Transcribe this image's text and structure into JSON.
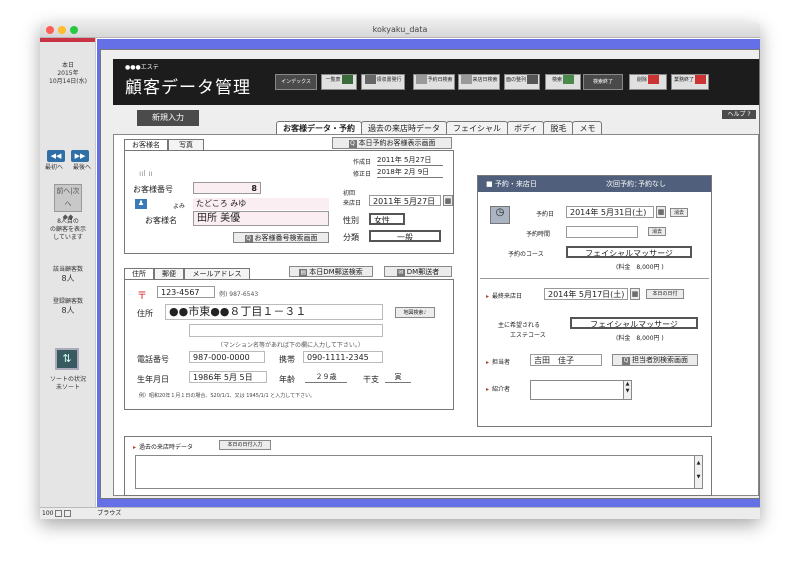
{
  "window": {
    "title": "kokyaku_data"
  },
  "sidebar": {
    "date_label": "本日",
    "date_year": "2015年",
    "date_md": "10月14日(水)",
    "nav_prev": "最初へ",
    "nav_last": "最後へ",
    "pad_prev": "前へ",
    "pad_next": "次へ",
    "record_info": "8人目の",
    "record_info2": "の顧客を表示",
    "record_info3": "しています",
    "found_label": "該当顧客数",
    "found_value": "8人",
    "total_label": "登録顧客数",
    "total_value": "8人",
    "sort_label": "ソートの状況",
    "sort_value": "未ソート"
  },
  "status": {
    "zoom": "100",
    "mode": "ブラウズ"
  },
  "header": {
    "subtitle": "●●●エステ",
    "title": "顧客データ管理",
    "tb_index": "インデックス",
    "tb_list": "一覧表",
    "tb_receipt": "領収書発行",
    "tb_reserve": "予約日検索",
    "tb_visit": "来店日検索",
    "tb_appear": "面の整列",
    "tb_search": "検索",
    "tb_search_end": "検索終了",
    "tb_delete": "削除",
    "tb_exit": "業務終了"
  },
  "toolbar": {
    "new_entry": "新規入力",
    "help": "ヘルプ ?"
  },
  "tabs": [
    "お客様データ・予約",
    "過去の来店時データ",
    "フェイシャル",
    "ボディ",
    "脱毛",
    "メモ"
  ],
  "customer": {
    "tab_name": "お客様名",
    "tab_photo": "写真",
    "today_btn": "本日予約お客様表示画面",
    "created_label": "作成日",
    "created": "2011年 5月27日",
    "modified_label": "修正日",
    "modified": "2018年 2月 9日",
    "num_label": "お客様番号",
    "num": "8",
    "first_visit_l1": "初回",
    "first_visit_l2": "来店日",
    "first_visit": "2011年 5月27日",
    "yomi_label": "よみ",
    "yomi": "たどころ みゆ",
    "name_label": "お客様名",
    "name": "田所 美優",
    "gender_label": "性別",
    "gender": "女性",
    "category_label": "分類",
    "category": "一般",
    "num_search_btn": "お客様番号検索画面"
  },
  "address": {
    "tab_addr": "住所",
    "tab_post": "郵便",
    "tab_mail": "メールアドレス",
    "dm_btn": "本日DM郵送検索",
    "dm_person_btn": "DM郵送者",
    "zip": "123-4567",
    "zip_example": "例) 987-6543",
    "addr_label": "住所",
    "addr": "●●市東●●８丁目１－３１",
    "addr_search": "地図検索",
    "note": "（マンション名等があれば下の欄に入力して下さい。）",
    "tel_label": "電話番号",
    "tel": "987-000-0000",
    "mobile_label": "携帯",
    "mobile": "090-1111-2345",
    "birth_label": "生年月日",
    "birth": "1986年 5月 5日",
    "age_label": "年齢",
    "age": "２９歳",
    "eto_label": "干支",
    "eto": "寅",
    "birth_note": "例）昭和20年１月１日の場合、S20/1/1、又は 1945/1/1 と入力して下さい。"
  },
  "reserve": {
    "header": "予約・来店日",
    "next_label": "次回予約：",
    "next_value": "予約なし",
    "date_label": "予約日",
    "date": "2014年 5月31日(土)",
    "erase": "消去",
    "time_label": "予約時間",
    "erase2": "消去",
    "course_label": "予約のコース",
    "course": "フェイシャルマッサージ",
    "fee": "(料金　8,000円 )",
    "last_visit_label": "最終来店日",
    "last_visit": "2014年 5月17日(土)",
    "today_btn": "本日の日付",
    "wish_l1": "主に希望される",
    "wish_l2": "エステコース",
    "wish": "フェイシャルマッサージ",
    "wish_fee": "(料金　8,000円 )",
    "staff_label": "担当者",
    "staff": "吉田　佳子",
    "staff_btn": "担当者別検索画面",
    "intro_label": "紹介者"
  },
  "history": {
    "label": "過去の来店時データ",
    "btn": "本日の日付入力"
  }
}
